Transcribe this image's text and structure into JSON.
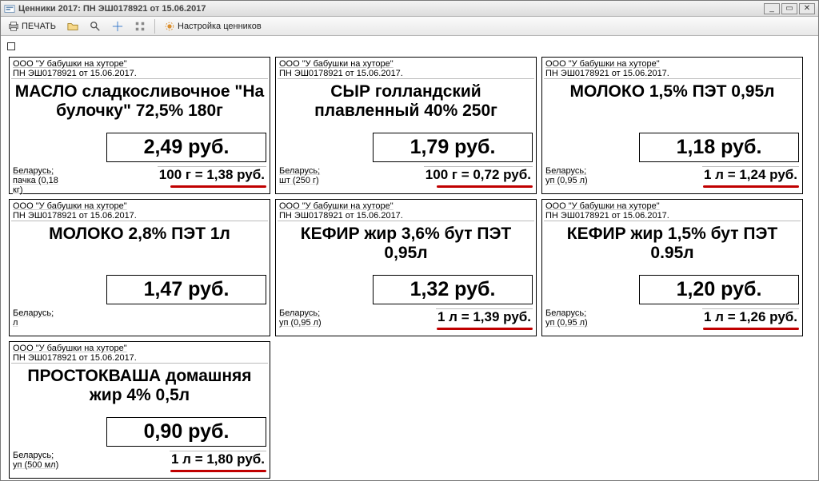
{
  "window": {
    "title": "Ценники 2017: ПН ЭШ0178921 от 15.06.2017"
  },
  "toolbar": {
    "print_label": "ПЕЧАТЬ",
    "settings_label": "Настройка ценников"
  },
  "common": {
    "org": "ООО \"У бабушки на хуторе\"",
    "doc": "ПН ЭШ0178921 от 15.06.2017."
  },
  "tags": [
    {
      "name": "МАСЛО сладкосливочное \"На булочку\" 72,5% 180г",
      "country": "Беларусь;",
      "pack": "пачка (0,18 кг)",
      "price": "2,49 руб.",
      "unit_price": "100 г = 1,38 руб."
    },
    {
      "name": "СЫР голландский плавленный 40% 250г",
      "country": "Беларусь;",
      "pack": "шт (250 г)",
      "price": "1,79 руб.",
      "unit_price": "100 г = 0,72 руб."
    },
    {
      "name": "МОЛОКО 1,5% ПЭТ 0,95л",
      "country": "Беларусь;",
      "pack": "уп (0,95 л)",
      "price": "1,18 руб.",
      "unit_price": "1 л = 1,24 руб."
    },
    {
      "name": "МОЛОКО 2,8% ПЭТ 1л",
      "country": "Беларусь;",
      "pack": "л",
      "price": "1,47 руб.",
      "unit_price": ""
    },
    {
      "name": "КЕФИР  жир 3,6% бут ПЭТ 0,95л",
      "country": "Беларусь;",
      "pack": "уп (0,95 л)",
      "price": "1,32 руб.",
      "unit_price": "1 л = 1,39 руб."
    },
    {
      "name": "КЕФИР жир 1,5% бут ПЭТ 0.95л",
      "country": "Беларусь;",
      "pack": "уп (0,95 л)",
      "price": "1,20 руб.",
      "unit_price": "1 л = 1,26 руб."
    },
    {
      "name": "ПРОСТОКВАША домашняя жир 4% 0,5л",
      "country": "Беларусь;",
      "pack": "уп (500 мл)",
      "price": "0,90 руб.",
      "unit_price": "1 л = 1,80 руб."
    }
  ]
}
